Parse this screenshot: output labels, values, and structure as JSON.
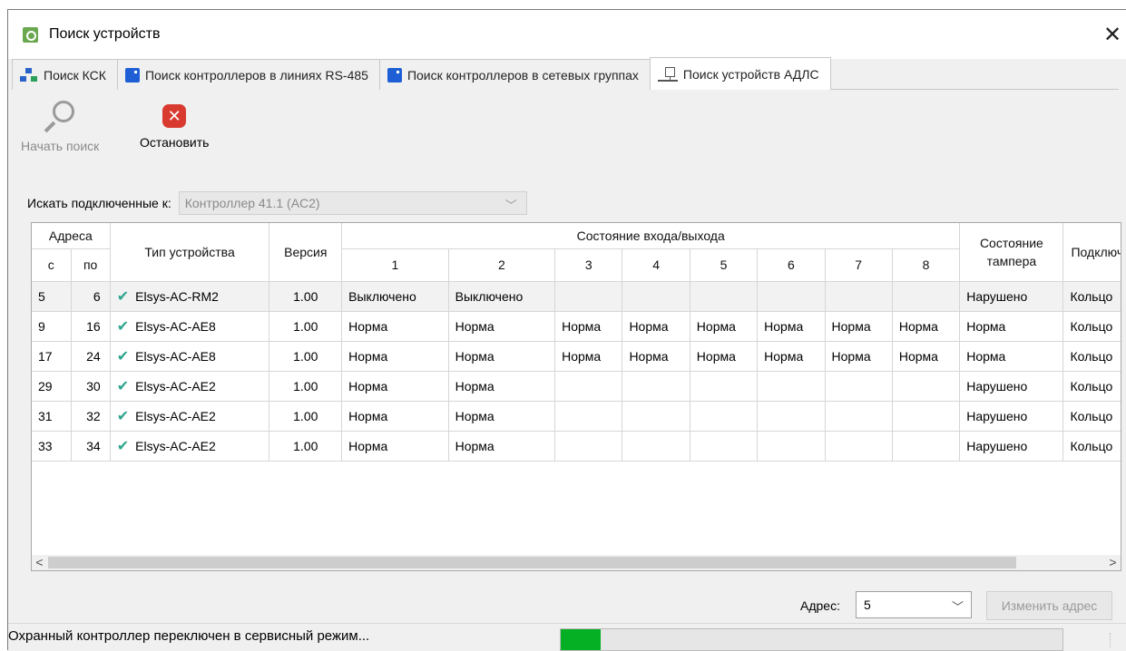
{
  "window": {
    "title": "Поиск устройств",
    "close_glyph": "✕"
  },
  "tabs": [
    {
      "label": "Поиск КСК",
      "icon": "network-icon"
    },
    {
      "label": "Поиск контроллеров в линиях RS-485",
      "icon": "controller-icon"
    },
    {
      "label": "Поиск контроллеров в сетевых группах",
      "icon": "controller-icon"
    },
    {
      "label": "Поиск устройств АДЛС",
      "icon": "adls-bus-icon",
      "active": true
    }
  ],
  "toolbar": {
    "start_label": "Начать поиск",
    "stop_label": "Остановить",
    "stop_glyph": "✕"
  },
  "filter": {
    "label": "Искать подключенные к:",
    "value": "Контроллер 41.1 (AC2)"
  },
  "table": {
    "headers": {
      "addresses": "Адреса",
      "from": "с",
      "to": "по",
      "device_type": "Тип устройства",
      "version": "Версия",
      "io_state": "Состояние входа/выхода",
      "io_cols": [
        "1",
        "2",
        "3",
        "4",
        "5",
        "6",
        "7",
        "8"
      ],
      "tamper": "Состояние тампера",
      "connection": "Подключ"
    },
    "rows": [
      {
        "from": "5",
        "to": "6",
        "type": "Elsys-AC-RM2",
        "version": "1.00",
        "io": [
          "Выключено",
          "Выключено",
          "",
          "",
          "",
          "",
          "",
          ""
        ],
        "tamper": "Нарушено",
        "conn": "Кольцо"
      },
      {
        "from": "9",
        "to": "16",
        "type": "Elsys-AC-AE8",
        "version": "1.00",
        "io": [
          "Норма",
          "Норма",
          "Норма",
          "Норма",
          "Норма",
          "Норма",
          "Норма",
          "Норма"
        ],
        "tamper": "Норма",
        "conn": "Кольцо"
      },
      {
        "from": "17",
        "to": "24",
        "type": "Elsys-AC-AE8",
        "version": "1.00",
        "io": [
          "Норма",
          "Норма",
          "Норма",
          "Норма",
          "Норма",
          "Норма",
          "Норма",
          "Норма"
        ],
        "tamper": "Норма",
        "conn": "Кольцо"
      },
      {
        "from": "29",
        "to": "30",
        "type": "Elsys-AC-AE2",
        "version": "1.00",
        "io": [
          "Норма",
          "Норма",
          "",
          "",
          "",
          "",
          "",
          ""
        ],
        "tamper": "Нарушено",
        "conn": "Кольцо"
      },
      {
        "from": "31",
        "to": "32",
        "type": "Elsys-AC-AE2",
        "version": "1.00",
        "io": [
          "Норма",
          "Норма",
          "",
          "",
          "",
          "",
          "",
          ""
        ],
        "tamper": "Нарушено",
        "conn": "Кольцо"
      },
      {
        "from": "33",
        "to": "34",
        "type": "Elsys-AC-AE2",
        "version": "1.00",
        "io": [
          "Норма",
          "Норма",
          "",
          "",
          "",
          "",
          "",
          ""
        ],
        "tamper": "Нарушено",
        "conn": "Кольцо"
      }
    ]
  },
  "address": {
    "label": "Адрес:",
    "value": "5",
    "change_label": "Изменить адрес"
  },
  "status": {
    "text": "Охранный контроллер переключен в сервисный режим...",
    "progress": 0.08
  },
  "colors": {
    "progress_fill": "#06b025",
    "stop_red": "#d93a2f",
    "check_green": "#2ea58e"
  }
}
